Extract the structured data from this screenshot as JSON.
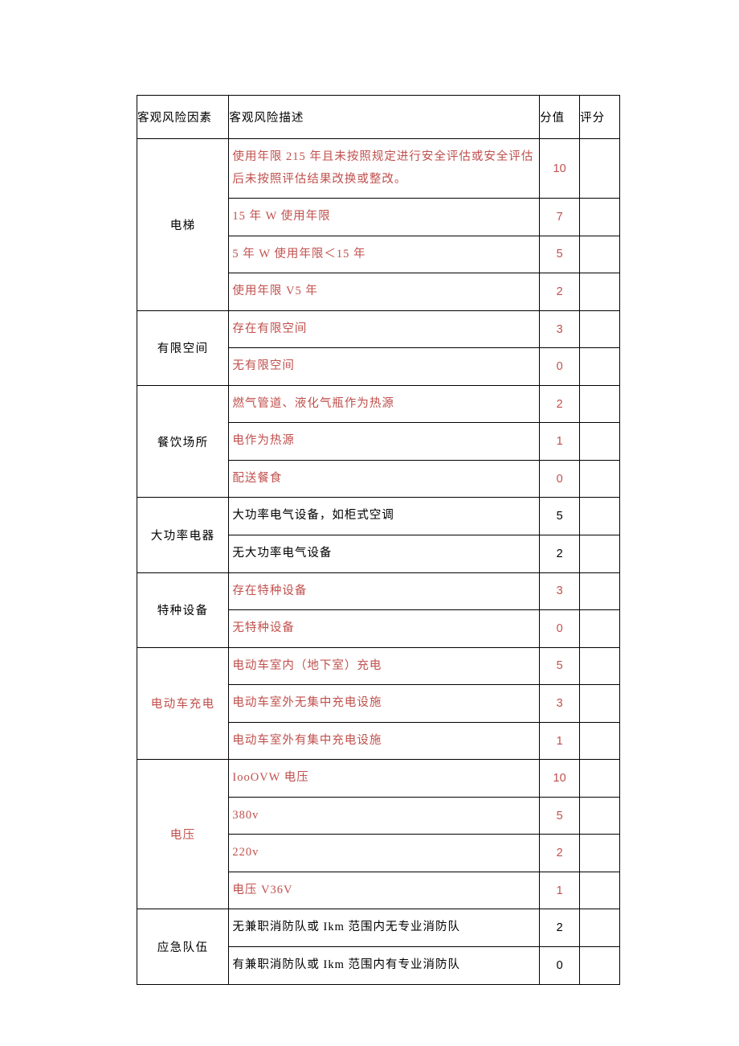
{
  "header": {
    "factor": "客观风险因素",
    "desc": "客观风险描述",
    "score": "分值",
    "rating": "评分"
  },
  "groups": [
    {
      "factor": "电梯",
      "factor_color": "black",
      "rows": [
        {
          "desc": "使用年限 215 年且未按照规定进行安全评估或安全评估后未按照评估结果改换或整改。",
          "score": "10",
          "color": "red"
        },
        {
          "desc": "15 年 W 使用年限",
          "score": "7",
          "color": "red"
        },
        {
          "desc": "5 年 W 使用年限＜15 年",
          "score": "5",
          "color": "red"
        },
        {
          "desc": "使用年限 V5 年",
          "score": "2",
          "color": "red"
        }
      ]
    },
    {
      "factor": "有限空间",
      "factor_color": "black",
      "rows": [
        {
          "desc": "存在有限空间",
          "score": "3",
          "color": "red"
        },
        {
          "desc": "无有限空间",
          "score": "0",
          "color": "red"
        }
      ]
    },
    {
      "factor": "餐饮场所",
      "factor_color": "black",
      "rows": [
        {
          "desc": "燃气管道、液化气瓶作为热源",
          "score": "2",
          "color": "red"
        },
        {
          "desc": "电作为热源",
          "score": "1",
          "color": "red"
        },
        {
          "desc": "配送餐食",
          "score": "0",
          "color": "red"
        }
      ]
    },
    {
      "factor": "大功率电器",
      "factor_color": "black",
      "rows": [
        {
          "desc": "大功率电气设备，如柜式空调",
          "score": "5",
          "color": "black"
        },
        {
          "desc": "无大功率电气设备",
          "score": "2",
          "color": "black"
        }
      ]
    },
    {
      "factor": "特种设备",
      "factor_color": "black",
      "rows": [
        {
          "desc": "存在特种设备",
          "score": "3",
          "color": "red"
        },
        {
          "desc": "无特种设备",
          "score": "0",
          "color": "red"
        }
      ]
    },
    {
      "factor": "电动车充电",
      "factor_color": "red",
      "rows": [
        {
          "desc": "电动车室内（地下室）充电",
          "score": "5",
          "color": "red"
        },
        {
          "desc": "电动车室外无集中充电设施",
          "score": "3",
          "color": "red"
        },
        {
          "desc": "电动车室外有集中充电设施",
          "score": "1",
          "color": "red"
        }
      ]
    },
    {
      "factor": "电压",
      "factor_color": "red",
      "rows": [
        {
          "desc": "IooOVW 电压",
          "score": "10",
          "color": "red"
        },
        {
          "desc": "380v",
          "score": "5",
          "color": "red"
        },
        {
          "desc": "220v",
          "score": "2",
          "color": "red"
        },
        {
          "desc": "电压 V36V",
          "score": "1",
          "color": "red"
        }
      ]
    },
    {
      "factor": "应急队伍",
      "factor_color": "black",
      "rows": [
        {
          "desc": "无兼职消防队或 Ikm 范围内无专业消防队",
          "score": "2",
          "color": "black"
        },
        {
          "desc": "有兼职消防队或 Ikm 范围内有专业消防队",
          "score": "0",
          "color": "black"
        }
      ]
    }
  ]
}
